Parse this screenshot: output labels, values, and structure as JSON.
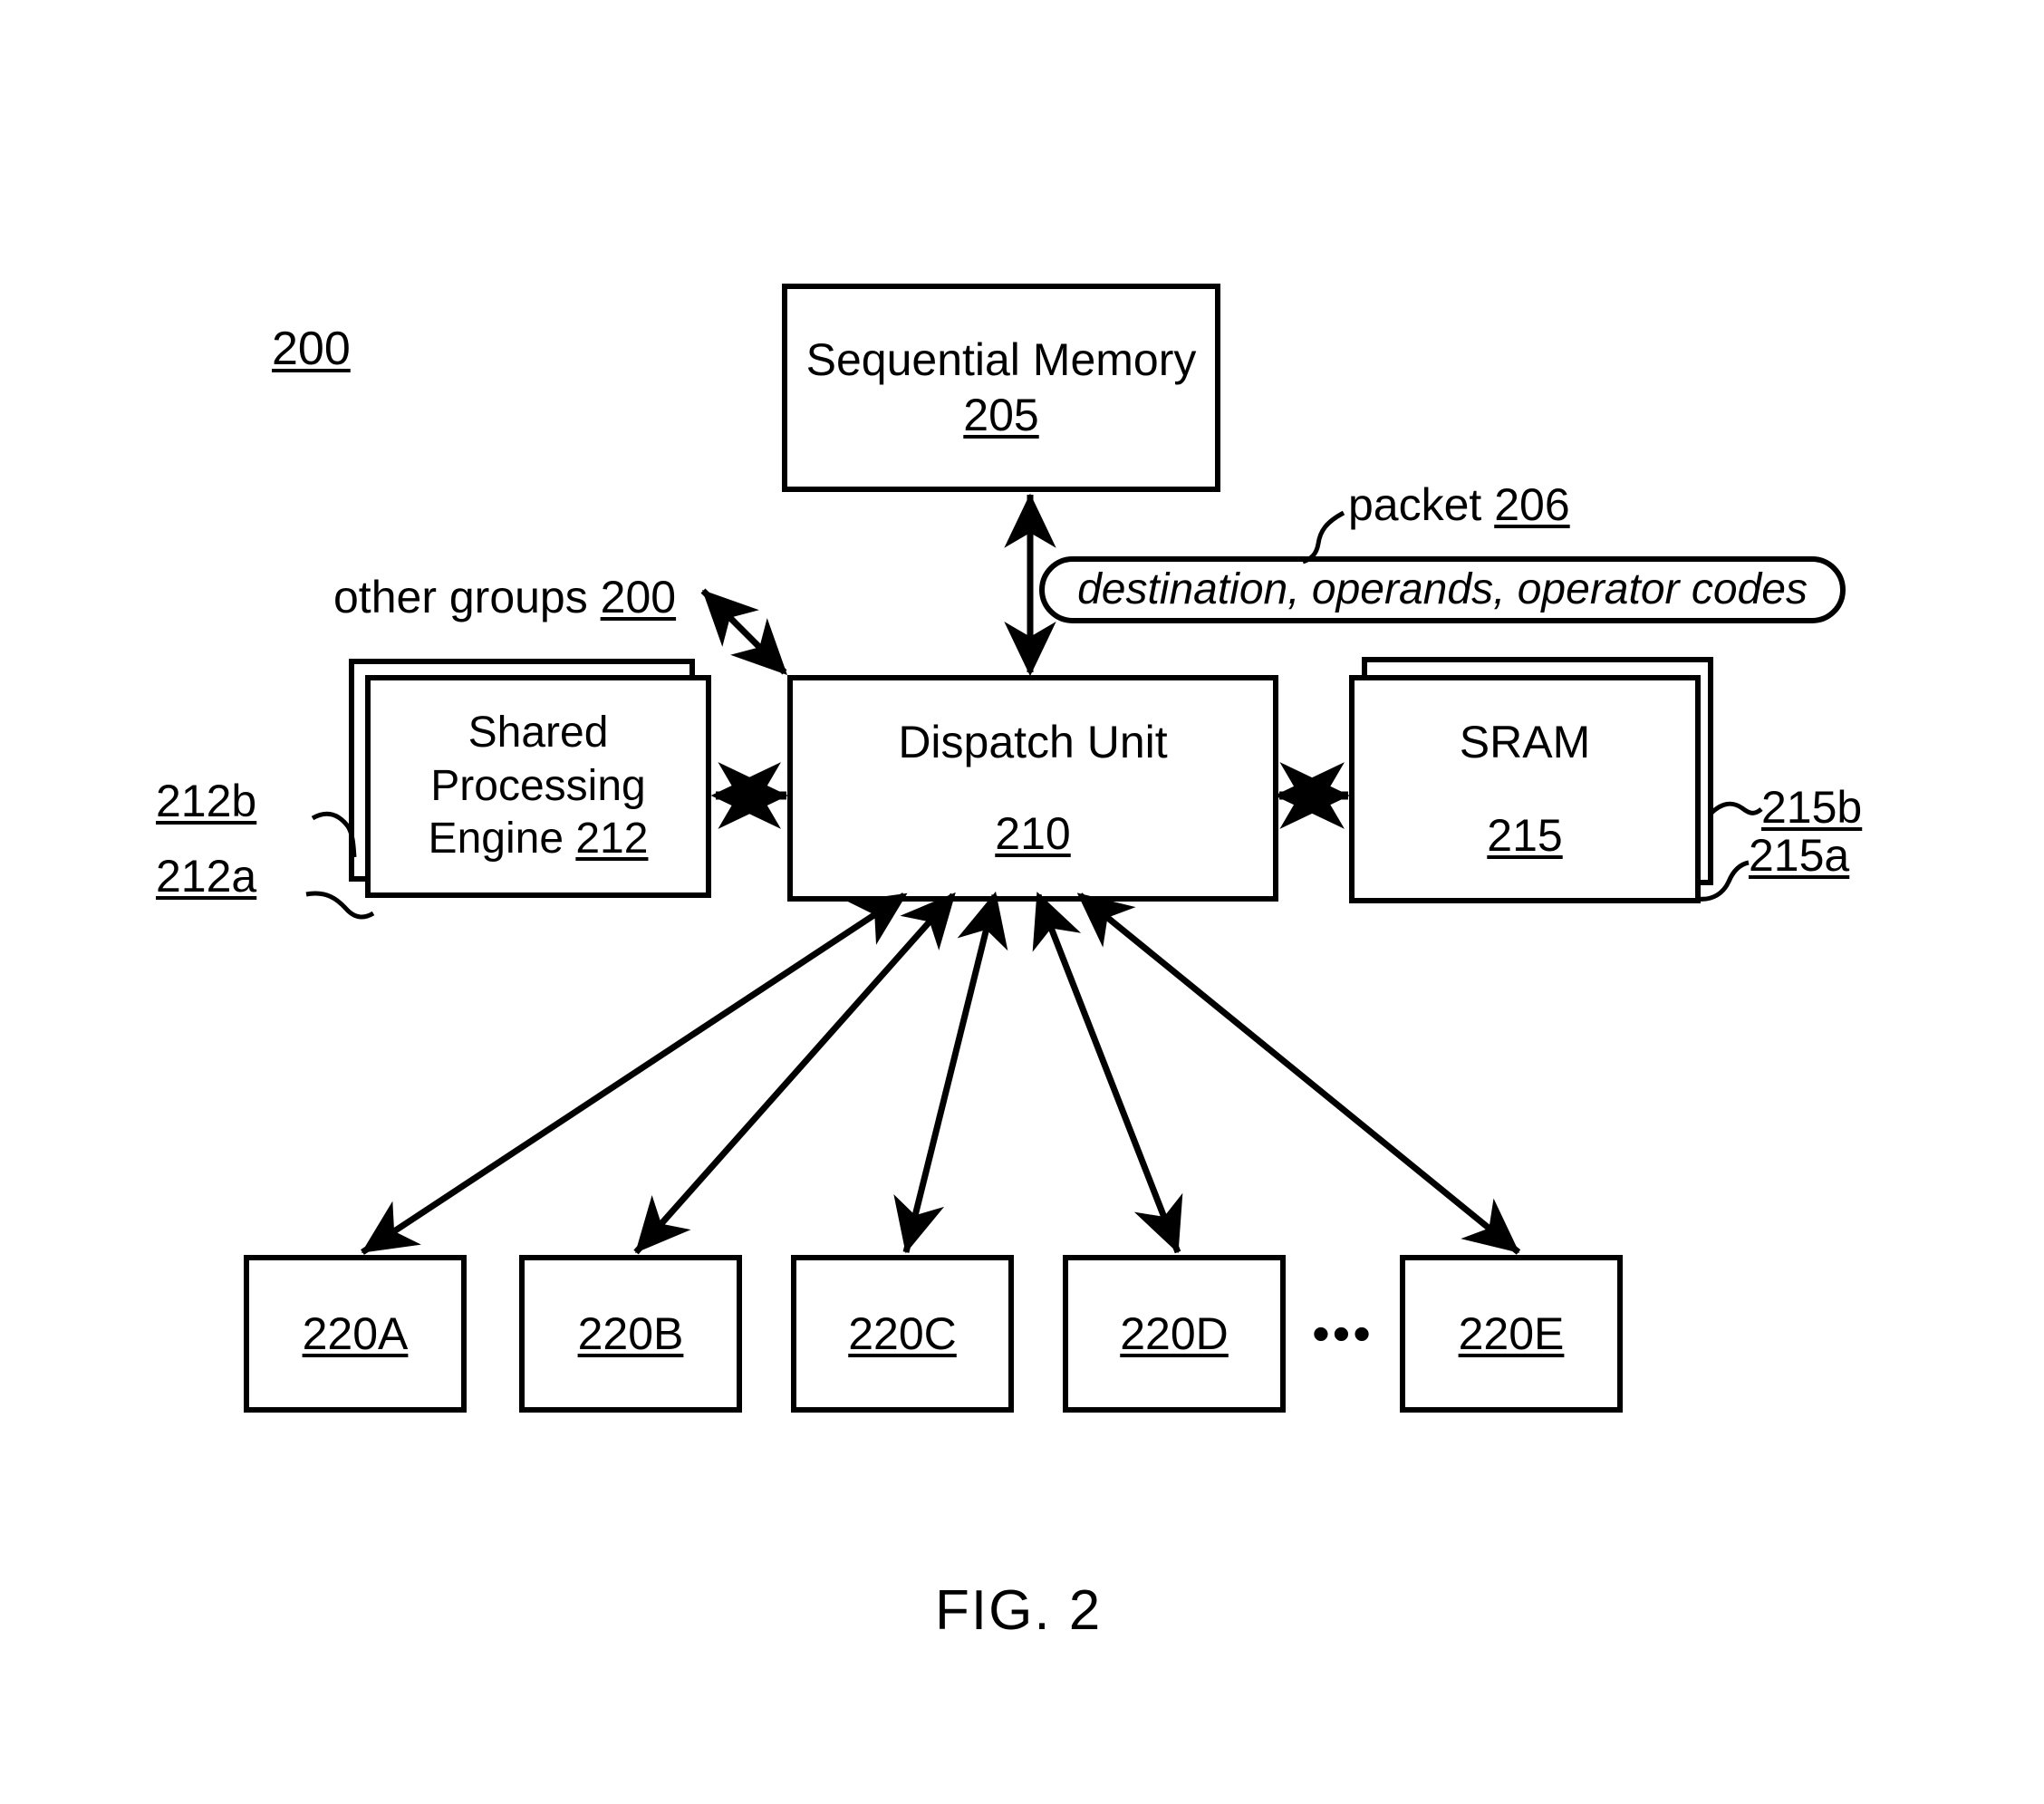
{
  "figure": {
    "caption": "FIG. 2",
    "system_ref": "200"
  },
  "blocks": {
    "sequential_memory": {
      "title": "Sequential Memory",
      "ref": "205"
    },
    "dispatch_unit": {
      "title": "Dispatch Unit",
      "ref": "210"
    },
    "shared_processing_engine": {
      "line1": "Shared",
      "line2": "Processing",
      "line3": "Engine",
      "ref": "212",
      "stack_labels": {
        "back": "212b",
        "front": "212a"
      }
    },
    "sram": {
      "title": "SRAM",
      "ref": "215",
      "stack_labels": {
        "back": "215b",
        "front": "215a"
      }
    },
    "processing_elements": [
      {
        "ref": "220A"
      },
      {
        "ref": "220B"
      },
      {
        "ref": "220C"
      },
      {
        "ref": "220D"
      },
      {
        "ref": "220E"
      }
    ],
    "ellipsis": "•••"
  },
  "annotations": {
    "other_groups": {
      "text": "other groups",
      "ref": "200"
    },
    "packet": {
      "text": "packet",
      "ref": "206",
      "contents": "destination, operands, operator codes"
    }
  },
  "colors": {
    "stroke": "#000000",
    "background": "#ffffff"
  }
}
